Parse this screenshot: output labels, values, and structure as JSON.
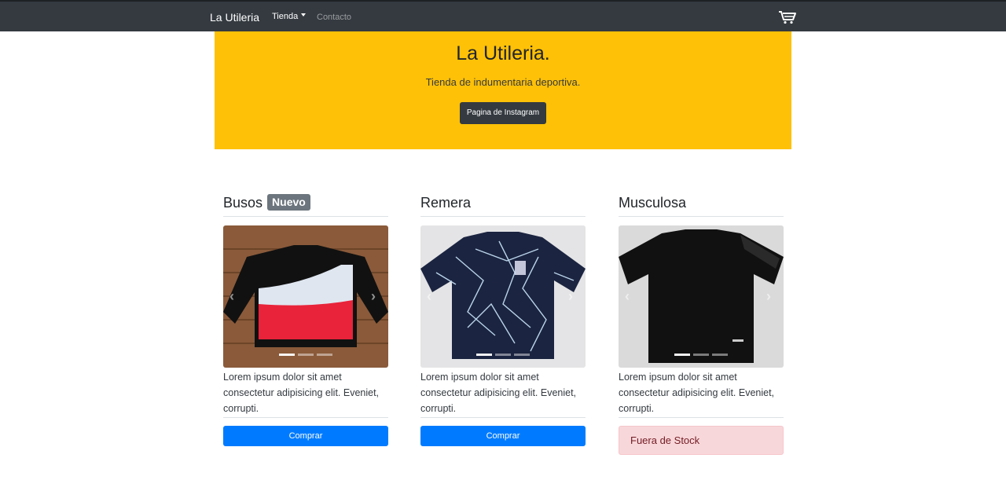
{
  "nav": {
    "brand": "La Utileria",
    "tienda": "Tienda",
    "contacto": "Contacto",
    "cart_icon": "cart-icon"
  },
  "hero": {
    "title": "La Utileria.",
    "subtitle": "Tienda de indumentaria deportiva.",
    "button": "Pagina de Instagram"
  },
  "products": [
    {
      "title": "Busos",
      "badge": "Nuevo",
      "text": "Lorem ipsum dolor sit amet consectetur adipisicing elit. Eveniet, corrupti.",
      "button": "Comprar"
    },
    {
      "title": "Remera",
      "text": "Lorem ipsum dolor sit amet consectetur adipisicing elit. Eveniet, corrupti.",
      "button": "Comprar"
    },
    {
      "title": "Musculosa",
      "text": "Lorem ipsum dolor sit amet consectetur adipisicing elit. Eveniet, corrupti.",
      "alert": "Fuera de Stock"
    }
  ],
  "colors": {
    "navbar": "#343a40",
    "hero": "#ffc107",
    "primary": "#007bff",
    "danger_bg": "#f8d7da"
  }
}
